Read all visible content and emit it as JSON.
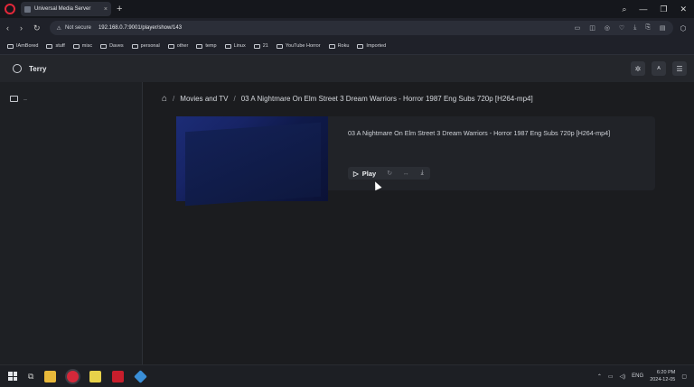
{
  "browser": {
    "tab_title": "Universal Media Server",
    "tab_close": "×",
    "new_tab": "+",
    "security_label": "Not secure",
    "url": "192.168.0.7:9001/player/show/143",
    "nav_icons": [
      "back-icon",
      "forward-icon",
      "reload-icon"
    ],
    "window_controls": [
      "search-icon",
      "minimize-icon",
      "maximize-icon",
      "close-icon"
    ]
  },
  "bookmarks": [
    {
      "label": "IAmBored"
    },
    {
      "label": "stuff"
    },
    {
      "label": "misc"
    },
    {
      "label": "Daves"
    },
    {
      "label": "personal"
    },
    {
      "label": "other"
    },
    {
      "label": "temp"
    },
    {
      "label": "Linux"
    },
    {
      "label": "21"
    },
    {
      "label": "YouTube Horror"
    },
    {
      "label": "Roku"
    },
    {
      "label": "Imported"
    }
  ],
  "app": {
    "username": "Terry",
    "sidebar_item": "..",
    "breadcrumb": {
      "level1": "Movies and TV",
      "level2": "03 A Nightmare On Elm Street 3 Dream Warriors - Horror 1987 Eng Subs 720p [H264-mp4]"
    },
    "media": {
      "title": "03 A Nightmare On Elm Street 3 Dream Warriors - Horror 1987 Eng Subs 720p [H264-mp4]",
      "play_label": "Play"
    }
  },
  "taskbar": {
    "language": "ENG",
    "time": "6:20 PM",
    "date": "2024-12-05"
  },
  "colors": {
    "accent": "#e3283a",
    "background": "#1b1c1f",
    "thumbnail_blue": "#1c2c76"
  }
}
